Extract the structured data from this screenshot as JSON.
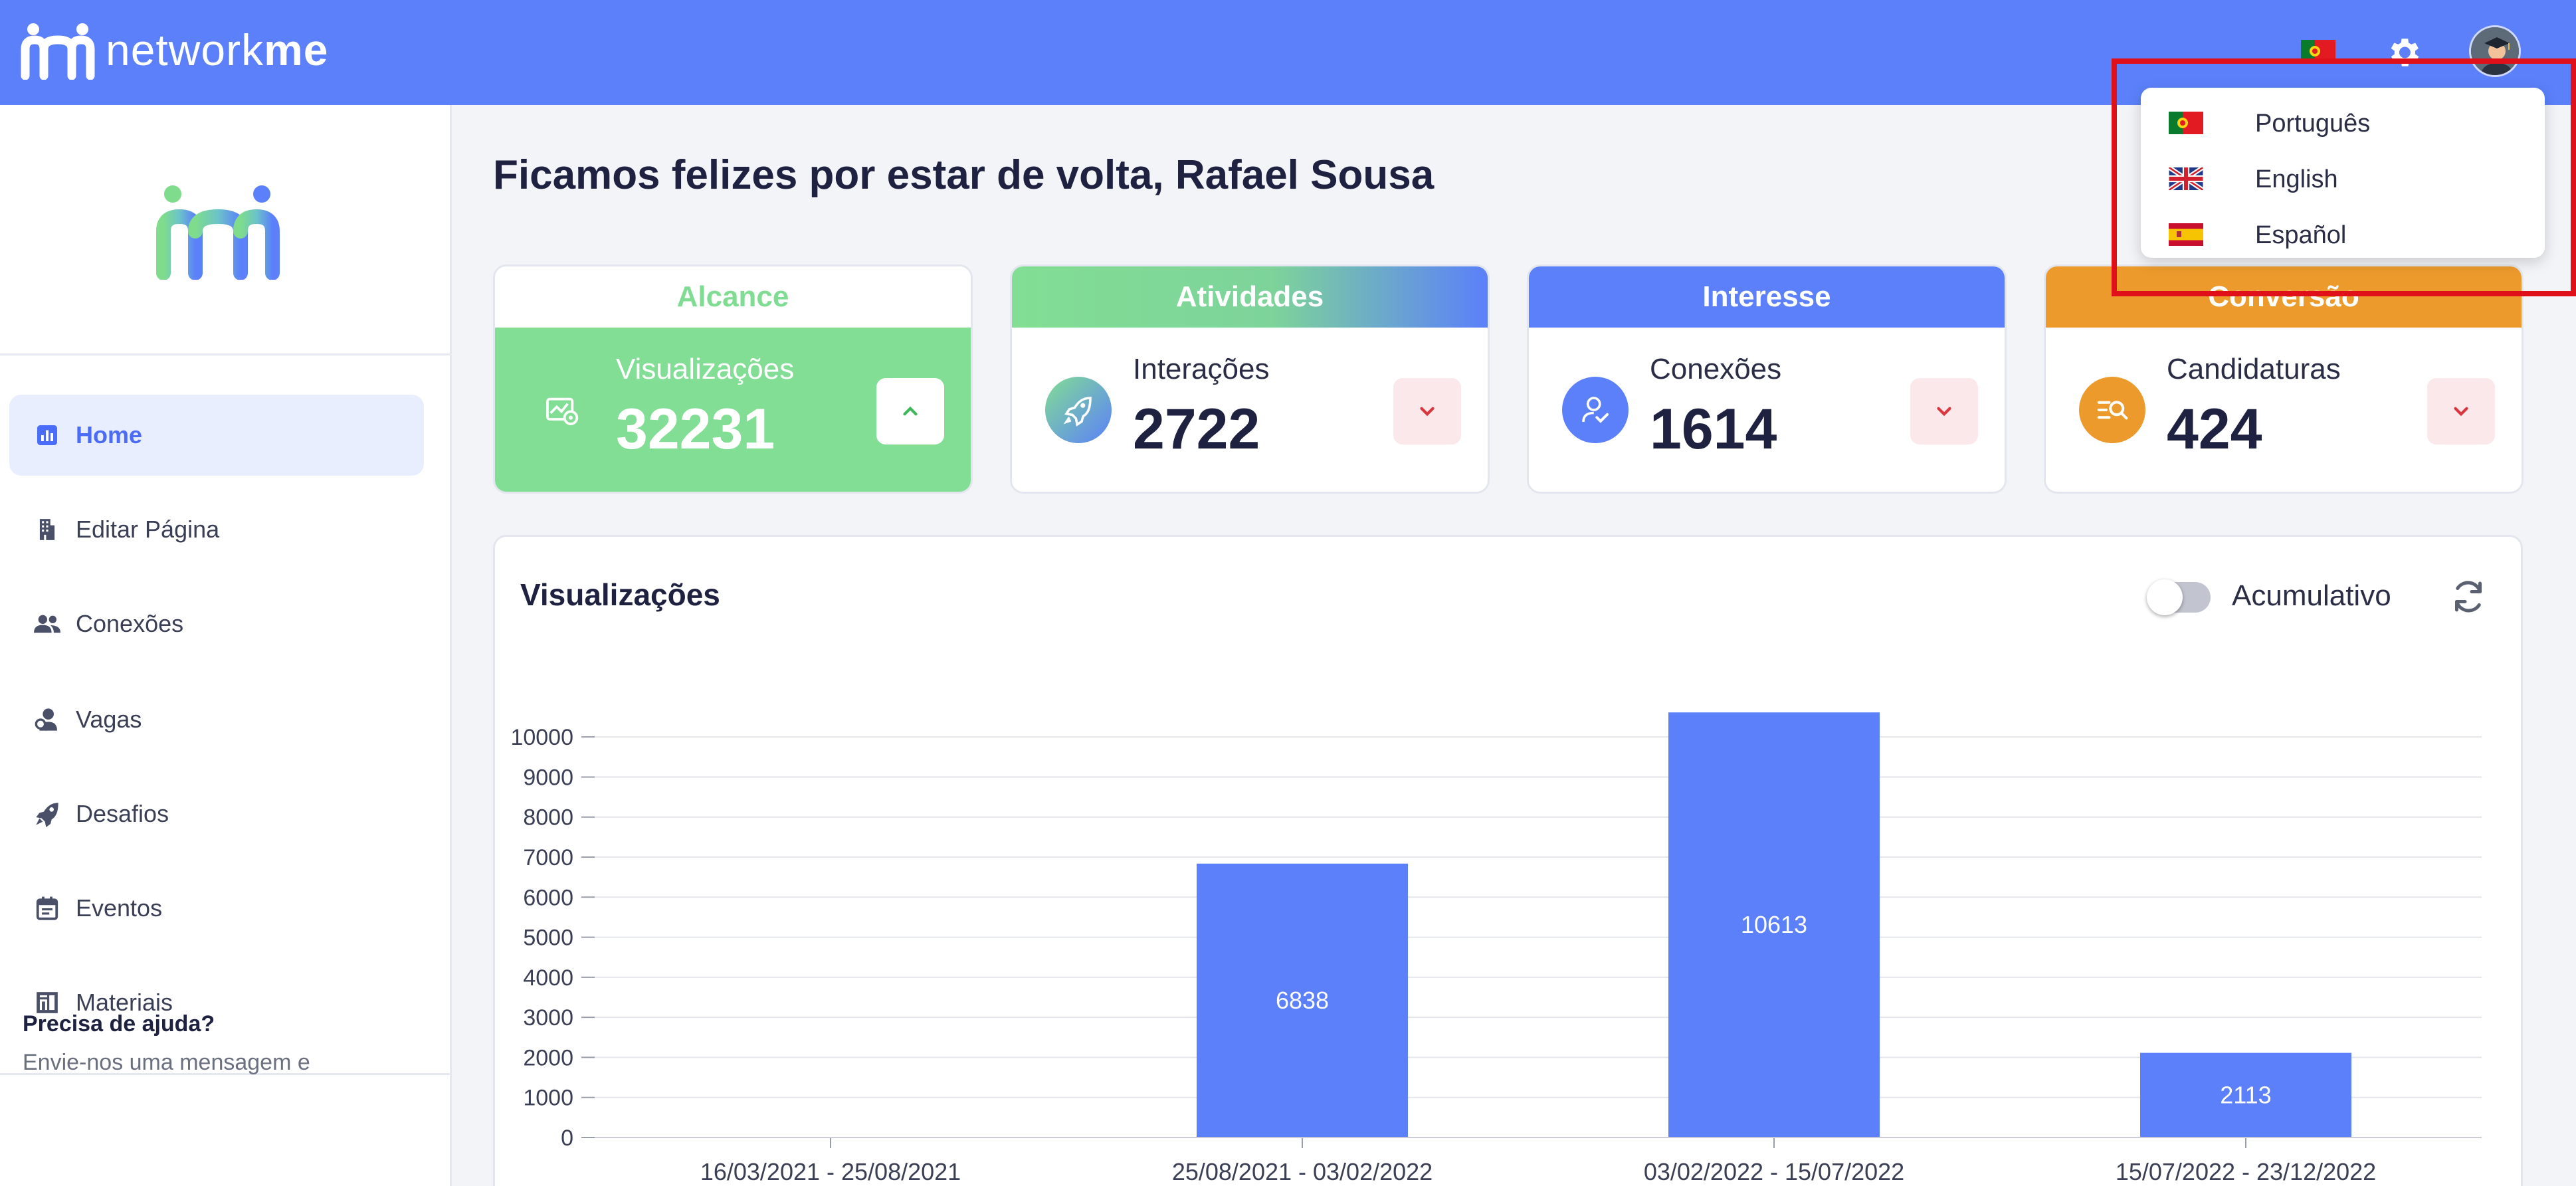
{
  "brand": {
    "name_light": "network",
    "name_bold": "me"
  },
  "header": {
    "flag_icon": "portugal-flag-icon",
    "settings_icon": "gear-icon",
    "avatar_icon": "graduate-avatar-icon"
  },
  "sidebar": {
    "items": [
      {
        "label": "Home",
        "icon": "bar-chart-icon",
        "active": true
      },
      {
        "label": "Editar Página",
        "icon": "building-icon",
        "active": false
      },
      {
        "label": "Conexões",
        "icon": "users-icon",
        "active": false
      },
      {
        "label": "Vagas",
        "icon": "user-search-icon",
        "active": false
      },
      {
        "label": "Desafios",
        "icon": "rocket-icon",
        "active": false
      },
      {
        "label": "Eventos",
        "icon": "calendar-icon",
        "active": false
      },
      {
        "label": "Materiais",
        "icon": "book-icon",
        "active": false
      }
    ],
    "help": {
      "title": "Precisa de ajuda?",
      "text": "Envie-nos uma mensagem e"
    }
  },
  "main": {
    "welcome": "Ficamos felizes por estar de volta, Rafael Sousa",
    "cards": [
      {
        "header": "Alcance",
        "label": "Visualizações",
        "value": "32231",
        "trend": "up",
        "color": "#82de94"
      },
      {
        "header": "Atividades",
        "label": "Interações",
        "value": "2722",
        "trend": "down",
        "color": "#6fa8e8"
      },
      {
        "header": "Interesse",
        "label": "Conexões",
        "value": "1614",
        "trend": "down",
        "color": "#5b80fa"
      },
      {
        "header": "Conversão",
        "label": "Candidaturas",
        "value": "424",
        "trend": "down",
        "color": "#ec9a2c"
      }
    ],
    "chart_panel": {
      "title": "Visualizações",
      "toggle_label": "Acumulativo",
      "toggle_on": false
    }
  },
  "chart_data": {
    "type": "bar",
    "categories": [
      "16/03/2021 - 25/08/2021",
      "25/08/2021 - 03/02/2022",
      "03/02/2022 - 15/07/2022",
      "15/07/2022 - 23/12/2022"
    ],
    "values": [
      0,
      6838,
      10613,
      2113
    ],
    "y_ticks": [
      0,
      1000,
      2000,
      3000,
      4000,
      5000,
      6000,
      7000,
      8000,
      9000,
      10000
    ],
    "ylim": [
      0,
      10600
    ],
    "grid": true,
    "bar_color": "#5b80fa"
  },
  "language_menu": {
    "items": [
      {
        "label": "Português",
        "flag": "portugal-flag-icon"
      },
      {
        "label": "English",
        "flag": "uk-flag-icon"
      },
      {
        "label": "Español",
        "flag": "spain-flag-icon"
      }
    ]
  }
}
